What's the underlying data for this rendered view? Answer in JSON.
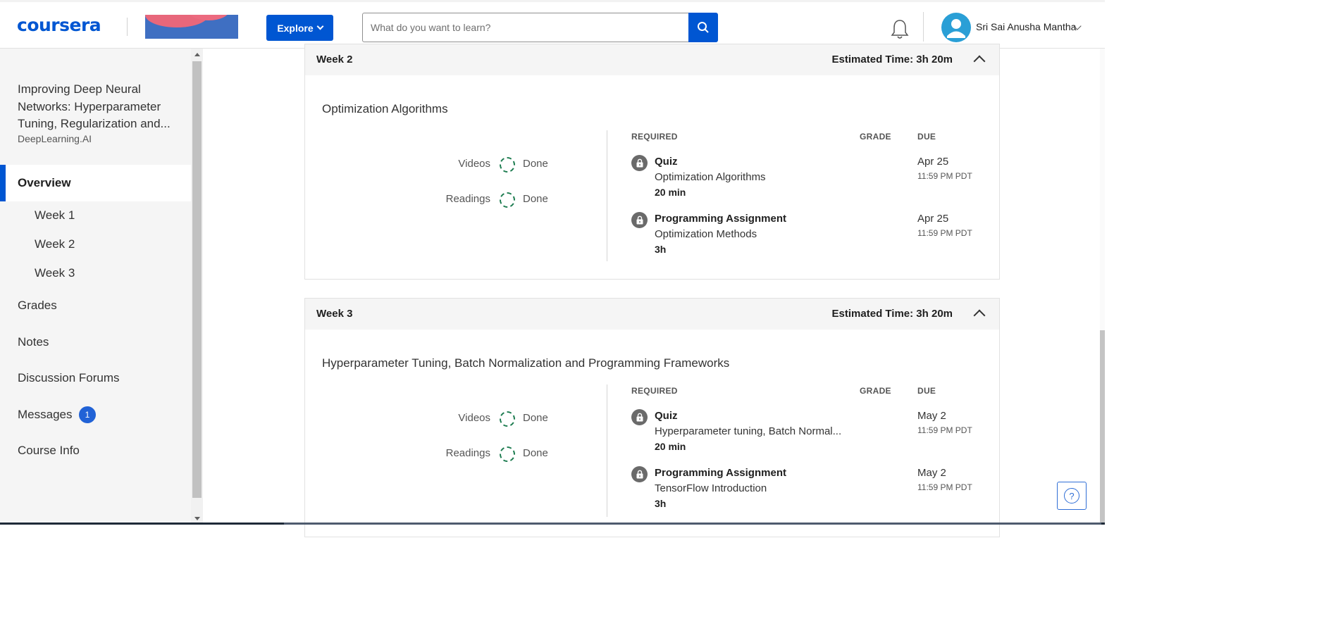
{
  "header": {
    "logo_text": "coursera",
    "explore_label": "Explore",
    "search_placeholder": "What do you want to learn?",
    "user_name": "Sri Sai Anusha Mantha"
  },
  "sidebar": {
    "course_title": "Improving Deep Neural Networks: Hyperparameter Tuning, Regularization and...",
    "partner": "DeepLearning.AI",
    "overview": "Overview",
    "weeks": [
      "Week 1",
      "Week 2",
      "Week 3"
    ],
    "grades": "Grades",
    "notes": "Notes",
    "forums": "Discussion Forums",
    "messages": "Messages",
    "messages_count": "1",
    "course_info": "Course Info"
  },
  "weeks": [
    {
      "title": "Week 2",
      "estimated": "Estimated Time: 3h 20m",
      "module": "Optimization Algorithms",
      "videos_label": "Videos",
      "videos_status": "Done",
      "readings_label": "Readings",
      "readings_status": "Done",
      "col_required": "REQUIRED",
      "col_grade": "GRADE",
      "col_due": "DUE",
      "items": [
        {
          "type": "Quiz",
          "name": "Optimization Algorithms",
          "duration": "20 min",
          "due_date": "Apr 25",
          "due_time": "11:59 PM PDT"
        },
        {
          "type": "Programming Assignment",
          "name": "Optimization Methods",
          "duration": "3h",
          "due_date": "Apr 25",
          "due_time": "11:59 PM PDT"
        }
      ]
    },
    {
      "title": "Week 3",
      "estimated": "Estimated Time: 3h 20m",
      "module": "Hyperparameter Tuning, Batch Normalization and Programming Frameworks",
      "videos_label": "Videos",
      "videos_status": "Done",
      "readings_label": "Readings",
      "readings_status": "Done",
      "col_required": "REQUIRED",
      "col_grade": "GRADE",
      "col_due": "DUE",
      "items": [
        {
          "type": "Quiz",
          "name": "Hyperparameter tuning, Batch Normal...",
          "duration": "20 min",
          "due_date": "May 2",
          "due_time": "11:59 PM PDT"
        },
        {
          "type": "Programming Assignment",
          "name": "TensorFlow Introduction",
          "duration": "3h",
          "due_date": "May 2",
          "due_time": "11:59 PM PDT"
        }
      ]
    }
  ],
  "help_label": "?",
  "colors": {
    "brand": "#0056d2",
    "done_ring": "#1d7c50",
    "badge": "#2162d6"
  }
}
